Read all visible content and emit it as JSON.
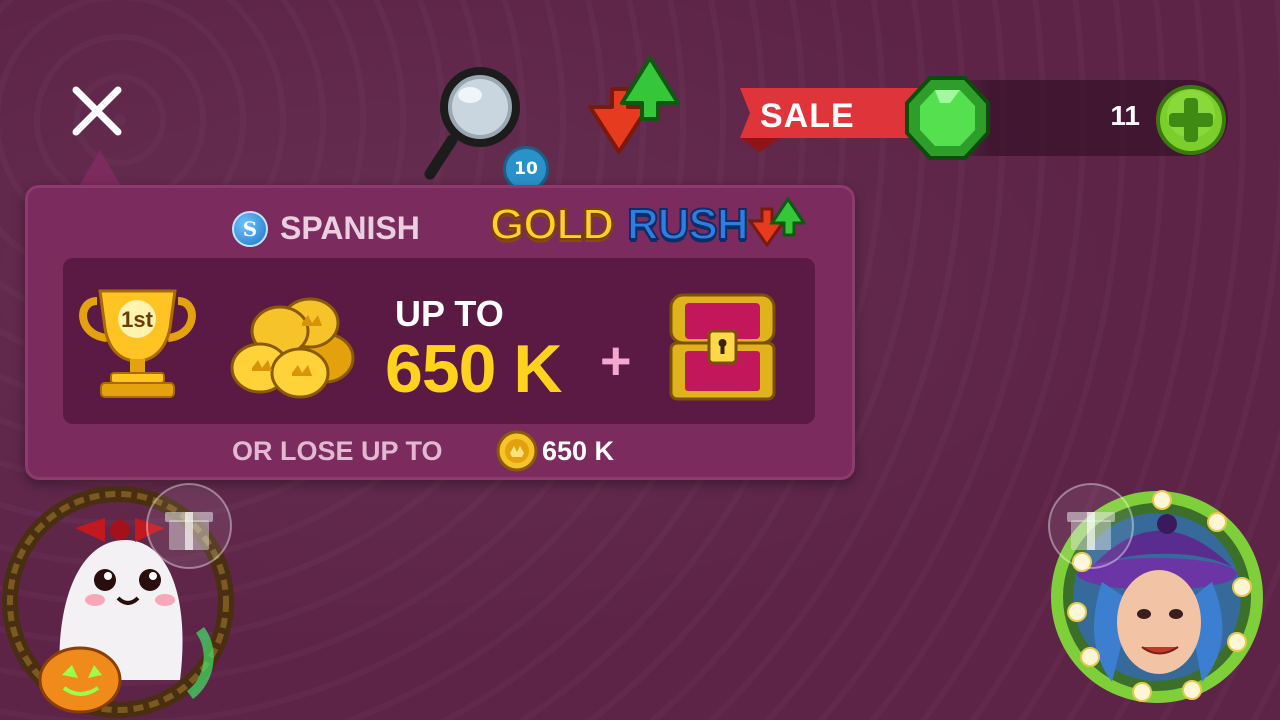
{
  "topbar": {
    "search_badge_count": "10",
    "sale_label": "SALE",
    "gem_count": "11",
    "icons": [
      "close-icon",
      "magnifier-icon",
      "swap-arrows-icon",
      "emerald-gem-icon",
      "plus-icon"
    ]
  },
  "popup": {
    "language_icon_letter": "S",
    "language_label": "SPANISH",
    "event_logo": {
      "part1": "GOLD",
      "part2": "RUSH"
    },
    "reward": {
      "place_label": "1st",
      "up_to_label": "UP TO",
      "up_to_value": "650 K",
      "plus": "+"
    },
    "lose": {
      "label": "OR LOSE UP TO",
      "value": "650 K"
    }
  },
  "players": {
    "left_avatar_icon": "ghost-halloween-avatar-icon",
    "right_avatar_icon": "witch-avatar-icon",
    "gift_icon": "gift-icon"
  },
  "colors": {
    "background": "#5e2448",
    "popup": "#7c2b5e",
    "panel": "#5b1a44",
    "gold": "#ffd21e",
    "sale_red": "#e0343b",
    "gem_green": "#3fcc3a",
    "plus_green": "#7ccf2b",
    "badge_blue": "#2a91c9"
  }
}
